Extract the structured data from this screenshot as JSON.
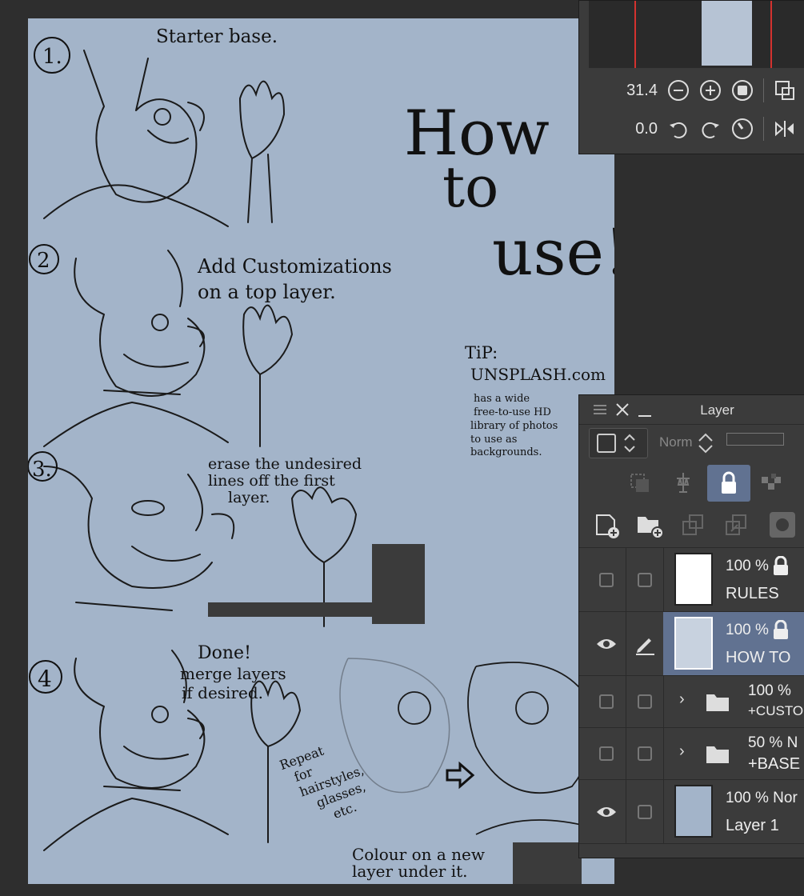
{
  "canvas": {
    "step1_num": "1.",
    "step1_caption": "Starter base.",
    "title_line1": "How",
    "title_line2": "to",
    "title_line3": "use!",
    "step2_num": "2",
    "step2_caption_line1": "Add Customizations",
    "step2_caption_line2": "on a top layer.",
    "tip_label": "TiP:",
    "tip_site": "UNSPLASH.com",
    "tip_body_1": "has a wide",
    "tip_body_2": "free-to-use HD",
    "tip_body_3": "library of photos",
    "tip_body_4": "to use as",
    "tip_body_5": "backgrounds.",
    "step3_num": "3.",
    "step3_caption_line1": "erase the undesired",
    "step3_caption_line2": "lines off the first",
    "step3_caption_line3": "layer.",
    "step4_num": "4",
    "step4_caption_line1": "Done!",
    "step4_caption_line2": "merge layers",
    "step4_caption_line3": "if desired.",
    "repeat_1": "Repeat",
    "repeat_2": "for",
    "repeat_3": "hairstyles,",
    "repeat_4": "glasses,",
    "repeat_5": "etc.",
    "colour_line1": "Colour on a new",
    "colour_line2": "layer under it.",
    "background_color": "#a3b4c9"
  },
  "navigator": {
    "zoom_value": "31.4",
    "rotation_value": "0.0"
  },
  "layer_panel": {
    "title": "Layer",
    "blend_mode": "Norm",
    "selected_color": "#617291",
    "layers": [
      {
        "opacity": "100 %",
        "name": "RULES",
        "visible": false,
        "locked": true
      },
      {
        "opacity": "100 %",
        "name": "HOW TO",
        "visible": true,
        "locked": true,
        "selected": true
      },
      {
        "opacity": "100 %",
        "name": "+CUSTO",
        "visible": false,
        "folder": true
      },
      {
        "opacity": "50 % N",
        "name": "+BASE",
        "visible": false,
        "folder": true
      },
      {
        "opacity": "100 % Nor",
        "name": "Layer 1",
        "visible": true
      }
    ]
  }
}
